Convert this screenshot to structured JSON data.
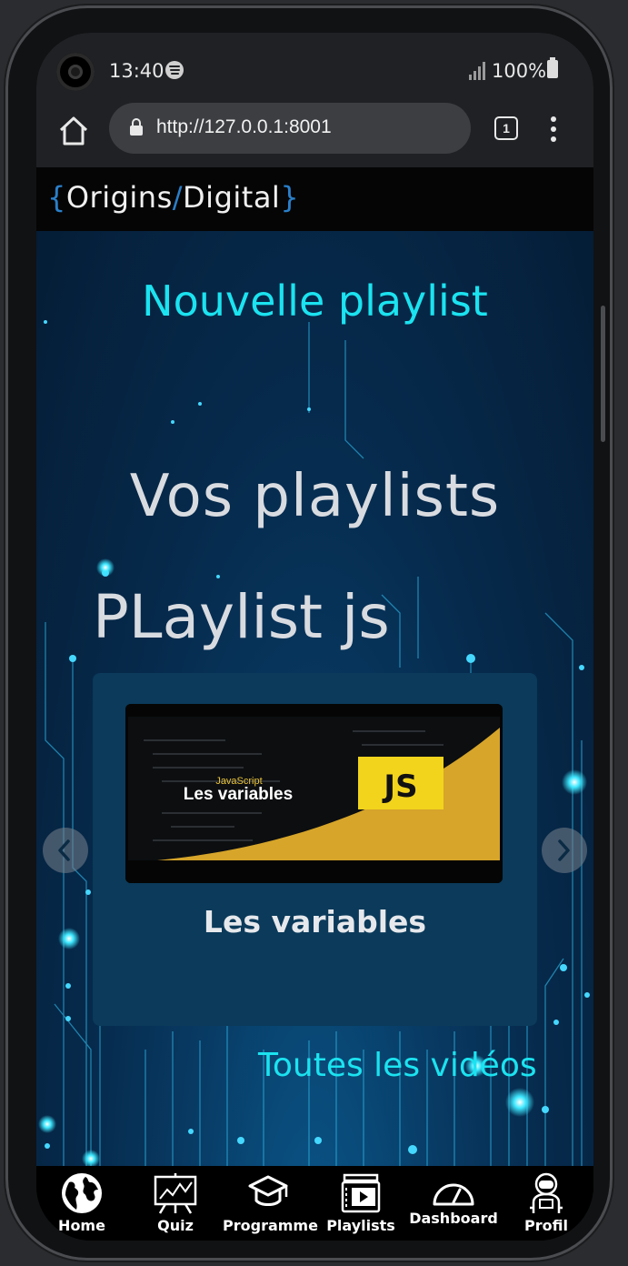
{
  "status_bar": {
    "time": "13:40",
    "battery": "100%",
    "icons": [
      "spotify-icon",
      "signal-icon",
      "battery-icon"
    ]
  },
  "browser": {
    "url": "http://127.0.0.1:8001",
    "tab_count": "1"
  },
  "site": {
    "logo": {
      "open_brace": "{",
      "part1": "Origins",
      "slash": "/",
      "part2": "Digital",
      "close_brace": "}"
    }
  },
  "main": {
    "new_playlist": "Nouvelle playlist",
    "section_title": "Vos playlists",
    "playlist_name": "PLaylist js",
    "carousel": {
      "video_title": "Les variables",
      "thumbnail": {
        "subtitle": "JavaScript",
        "title": "Les variables",
        "badge": "JS"
      }
    },
    "all_videos": "Toutes les vidéos"
  },
  "bottom_nav": {
    "items": [
      {
        "label": "Home",
        "icon": "globe-icon"
      },
      {
        "label": "Quiz",
        "icon": "chart-board-icon"
      },
      {
        "label": "Programme",
        "icon": "graduation-cap-icon"
      },
      {
        "label": "Playlists",
        "icon": "video-playlist-icon"
      },
      {
        "label": "Dashboard",
        "icon": "gauge-icon"
      },
      {
        "label": "Profil",
        "icon": "astronaut-icon"
      }
    ]
  },
  "colors": {
    "accent_cyan": "#1be3f0",
    "logo_blue": "#2a7fc9",
    "card_bg": "#0b3a5a",
    "js_yellow": "#f2d41c"
  }
}
